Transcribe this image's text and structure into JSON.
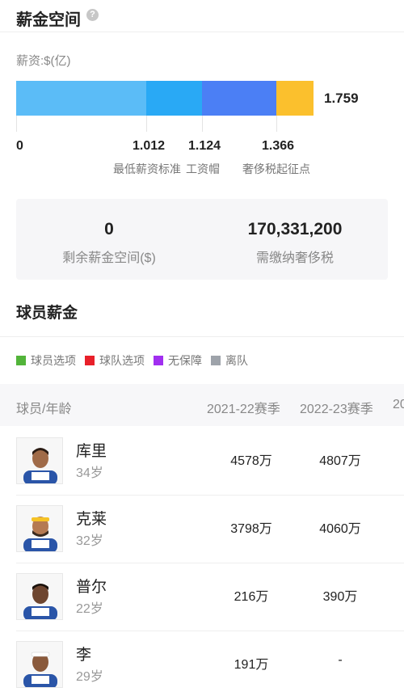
{
  "header": {
    "title": "薪金空间",
    "help_icon": "?"
  },
  "cap": {
    "unit_label": "薪资:$(亿)",
    "total_label": "1.759",
    "segments": [
      {
        "color": "#5bbcf7"
      },
      {
        "color": "#29a9f5"
      },
      {
        "color": "#4b7ff5"
      },
      {
        "color": "#fbc02d"
      }
    ],
    "ticks": [
      {
        "value": "0",
        "label": ""
      },
      {
        "value": "1.012",
        "label": "最低薪资标准"
      },
      {
        "value": "1.124",
        "label": "工资帽"
      },
      {
        "value": "1.366",
        "label": "奢侈税起征点"
      }
    ]
  },
  "summary": {
    "remaining_value": "0",
    "remaining_label": "剩余薪金空间($)",
    "tax_value": "170,331,200",
    "tax_label": "需缴纳奢侈税"
  },
  "players_section": {
    "title": "球员薪金",
    "legend": [
      {
        "label": "球员选项",
        "color": "#52b43a"
      },
      {
        "label": "球队选项",
        "color": "#e8202a"
      },
      {
        "label": "无保障",
        "color": "#a12ff0"
      },
      {
        "label": "离队",
        "color": "#9ea3aa"
      }
    ],
    "columns": {
      "player": "球员/年龄",
      "season1": "2021-22赛季",
      "season2": "2022-23赛季",
      "season3": "20"
    },
    "rows": [
      {
        "name": "库里",
        "age": "34岁",
        "s1": "4578万",
        "s2": "4807万"
      },
      {
        "name": "克莱",
        "age": "32岁",
        "s1": "3798万",
        "s2": "4060万"
      },
      {
        "name": "普尔",
        "age": "22岁",
        "s1": "216万",
        "s2": "390万"
      },
      {
        "name": "李",
        "age": "29岁",
        "s1": "191万",
        "s2": "-"
      }
    ]
  }
}
